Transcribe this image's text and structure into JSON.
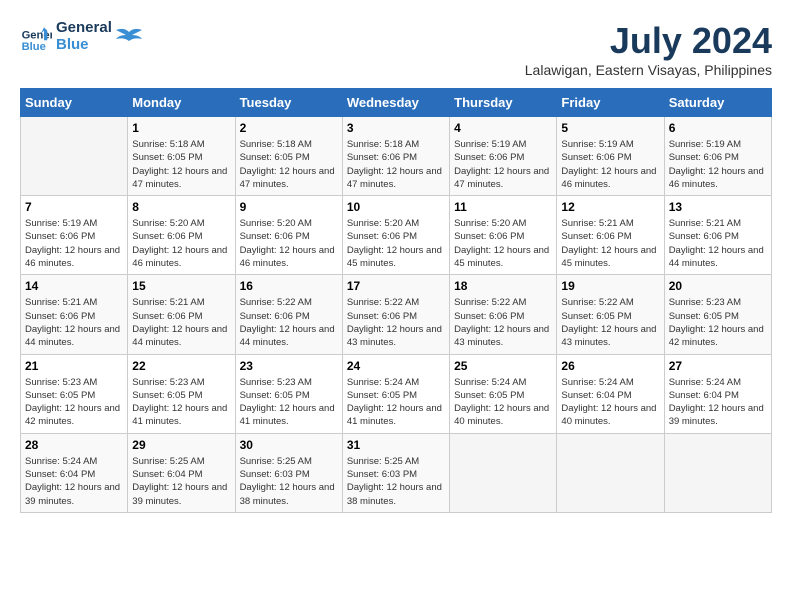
{
  "logo": {
    "line1": "General",
    "line2": "Blue"
  },
  "title": {
    "month_year": "July 2024",
    "location": "Lalawigan, Eastern Visayas, Philippines"
  },
  "days_of_week": [
    "Sunday",
    "Monday",
    "Tuesday",
    "Wednesday",
    "Thursday",
    "Friday",
    "Saturday"
  ],
  "weeks": [
    [
      {
        "day": "",
        "sunrise": "",
        "sunset": "",
        "daylight": ""
      },
      {
        "day": "1",
        "sunrise": "Sunrise: 5:18 AM",
        "sunset": "Sunset: 6:05 PM",
        "daylight": "Daylight: 12 hours and 47 minutes."
      },
      {
        "day": "2",
        "sunrise": "Sunrise: 5:18 AM",
        "sunset": "Sunset: 6:05 PM",
        "daylight": "Daylight: 12 hours and 47 minutes."
      },
      {
        "day": "3",
        "sunrise": "Sunrise: 5:18 AM",
        "sunset": "Sunset: 6:06 PM",
        "daylight": "Daylight: 12 hours and 47 minutes."
      },
      {
        "day": "4",
        "sunrise": "Sunrise: 5:19 AM",
        "sunset": "Sunset: 6:06 PM",
        "daylight": "Daylight: 12 hours and 47 minutes."
      },
      {
        "day": "5",
        "sunrise": "Sunrise: 5:19 AM",
        "sunset": "Sunset: 6:06 PM",
        "daylight": "Daylight: 12 hours and 46 minutes."
      },
      {
        "day": "6",
        "sunrise": "Sunrise: 5:19 AM",
        "sunset": "Sunset: 6:06 PM",
        "daylight": "Daylight: 12 hours and 46 minutes."
      }
    ],
    [
      {
        "day": "7",
        "sunrise": "Sunrise: 5:19 AM",
        "sunset": "Sunset: 6:06 PM",
        "daylight": "Daylight: 12 hours and 46 minutes."
      },
      {
        "day": "8",
        "sunrise": "Sunrise: 5:20 AM",
        "sunset": "Sunset: 6:06 PM",
        "daylight": "Daylight: 12 hours and 46 minutes."
      },
      {
        "day": "9",
        "sunrise": "Sunrise: 5:20 AM",
        "sunset": "Sunset: 6:06 PM",
        "daylight": "Daylight: 12 hours and 46 minutes."
      },
      {
        "day": "10",
        "sunrise": "Sunrise: 5:20 AM",
        "sunset": "Sunset: 6:06 PM",
        "daylight": "Daylight: 12 hours and 45 minutes."
      },
      {
        "day": "11",
        "sunrise": "Sunrise: 5:20 AM",
        "sunset": "Sunset: 6:06 PM",
        "daylight": "Daylight: 12 hours and 45 minutes."
      },
      {
        "day": "12",
        "sunrise": "Sunrise: 5:21 AM",
        "sunset": "Sunset: 6:06 PM",
        "daylight": "Daylight: 12 hours and 45 minutes."
      },
      {
        "day": "13",
        "sunrise": "Sunrise: 5:21 AM",
        "sunset": "Sunset: 6:06 PM",
        "daylight": "Daylight: 12 hours and 44 minutes."
      }
    ],
    [
      {
        "day": "14",
        "sunrise": "Sunrise: 5:21 AM",
        "sunset": "Sunset: 6:06 PM",
        "daylight": "Daylight: 12 hours and 44 minutes."
      },
      {
        "day": "15",
        "sunrise": "Sunrise: 5:21 AM",
        "sunset": "Sunset: 6:06 PM",
        "daylight": "Daylight: 12 hours and 44 minutes."
      },
      {
        "day": "16",
        "sunrise": "Sunrise: 5:22 AM",
        "sunset": "Sunset: 6:06 PM",
        "daylight": "Daylight: 12 hours and 44 minutes."
      },
      {
        "day": "17",
        "sunrise": "Sunrise: 5:22 AM",
        "sunset": "Sunset: 6:06 PM",
        "daylight": "Daylight: 12 hours and 43 minutes."
      },
      {
        "day": "18",
        "sunrise": "Sunrise: 5:22 AM",
        "sunset": "Sunset: 6:06 PM",
        "daylight": "Daylight: 12 hours and 43 minutes."
      },
      {
        "day": "19",
        "sunrise": "Sunrise: 5:22 AM",
        "sunset": "Sunset: 6:05 PM",
        "daylight": "Daylight: 12 hours and 43 minutes."
      },
      {
        "day": "20",
        "sunrise": "Sunrise: 5:23 AM",
        "sunset": "Sunset: 6:05 PM",
        "daylight": "Daylight: 12 hours and 42 minutes."
      }
    ],
    [
      {
        "day": "21",
        "sunrise": "Sunrise: 5:23 AM",
        "sunset": "Sunset: 6:05 PM",
        "daylight": "Daylight: 12 hours and 42 minutes."
      },
      {
        "day": "22",
        "sunrise": "Sunrise: 5:23 AM",
        "sunset": "Sunset: 6:05 PM",
        "daylight": "Daylight: 12 hours and 41 minutes."
      },
      {
        "day": "23",
        "sunrise": "Sunrise: 5:23 AM",
        "sunset": "Sunset: 6:05 PM",
        "daylight": "Daylight: 12 hours and 41 minutes."
      },
      {
        "day": "24",
        "sunrise": "Sunrise: 5:24 AM",
        "sunset": "Sunset: 6:05 PM",
        "daylight": "Daylight: 12 hours and 41 minutes."
      },
      {
        "day": "25",
        "sunrise": "Sunrise: 5:24 AM",
        "sunset": "Sunset: 6:05 PM",
        "daylight": "Daylight: 12 hours and 40 minutes."
      },
      {
        "day": "26",
        "sunrise": "Sunrise: 5:24 AM",
        "sunset": "Sunset: 6:04 PM",
        "daylight": "Daylight: 12 hours and 40 minutes."
      },
      {
        "day": "27",
        "sunrise": "Sunrise: 5:24 AM",
        "sunset": "Sunset: 6:04 PM",
        "daylight": "Daylight: 12 hours and 39 minutes."
      }
    ],
    [
      {
        "day": "28",
        "sunrise": "Sunrise: 5:24 AM",
        "sunset": "Sunset: 6:04 PM",
        "daylight": "Daylight: 12 hours and 39 minutes."
      },
      {
        "day": "29",
        "sunrise": "Sunrise: 5:25 AM",
        "sunset": "Sunset: 6:04 PM",
        "daylight": "Daylight: 12 hours and 39 minutes."
      },
      {
        "day": "30",
        "sunrise": "Sunrise: 5:25 AM",
        "sunset": "Sunset: 6:03 PM",
        "daylight": "Daylight: 12 hours and 38 minutes."
      },
      {
        "day": "31",
        "sunrise": "Sunrise: 5:25 AM",
        "sunset": "Sunset: 6:03 PM",
        "daylight": "Daylight: 12 hours and 38 minutes."
      },
      {
        "day": "",
        "sunrise": "",
        "sunset": "",
        "daylight": ""
      },
      {
        "day": "",
        "sunrise": "",
        "sunset": "",
        "daylight": ""
      },
      {
        "day": "",
        "sunrise": "",
        "sunset": "",
        "daylight": ""
      }
    ]
  ]
}
